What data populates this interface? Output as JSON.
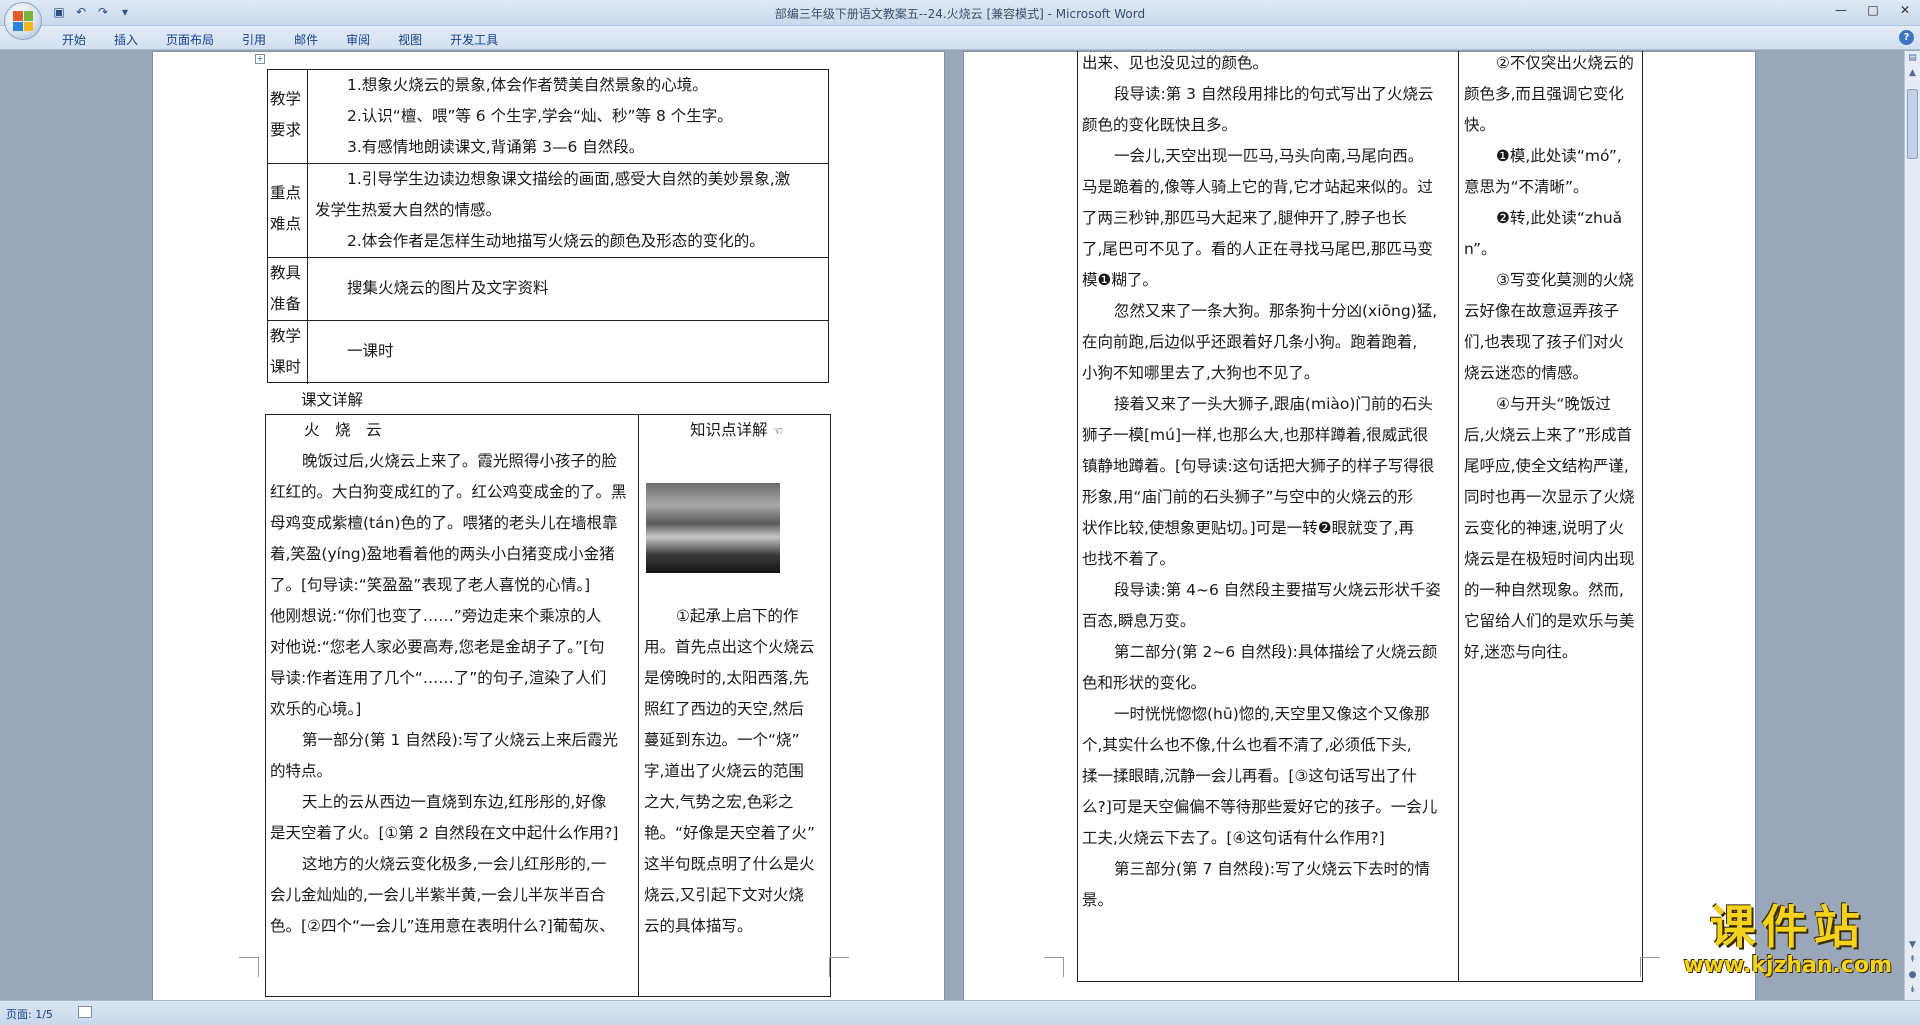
{
  "window": {
    "title": "部编三年级下册语文教案五--24.火烧云 [兼容模式] - Microsoft Word"
  },
  "ribbon": {
    "tabs": [
      "开始",
      "插入",
      "页面布局",
      "引用",
      "邮件",
      "审阅",
      "视图",
      "开发工具"
    ]
  },
  "status": {
    "page": "页面: 1/5"
  },
  "left_page": {
    "info_table": [
      {
        "label": [
          "教学",
          "要求"
        ],
        "lines": [
          "1.想象火烧云的景象,体会作者赞美自然景象的心境。",
          "2.认识“檀、喂”等 6 个生字,学会“灿、秒”等 8 个生字。",
          "3.有感情地朗读课文,背诵第 3—6 自然段。"
        ]
      },
      {
        "label": [
          "重点",
          "难点"
        ],
        "lines": [
          "1.引导学生边读边想象课文描绘的画面,感受大自然的美妙景象,激",
          "发学生热爱大自然的情感。",
          "2.体会作者是怎样生动地描写火烧云的颜色及形态的变化的。"
        ]
      },
      {
        "label": [
          "教具",
          "准备"
        ],
        "lines": [
          "搜集火烧云的图片及文字资料"
        ]
      },
      {
        "label": [
          "教学",
          "课时"
        ],
        "lines": [
          "一课时"
        ]
      }
    ],
    "section_title": "课文详解",
    "main_col": [
      "火　烧　云",
      "晚饭过后,火烧云上来了。霞光照得小孩子的脸",
      "红红的。大白狗变成红的了。红公鸡变成金的了。黑",
      "母鸡变成紫檀(tán)色的了。喂猪的老头儿在墙根靠",
      "着,笑盈(yíng)盈地看着他的两头小白猪变成小金猪",
      "了。[句导读:“笑盈盈”表现了老人喜悦的心情。]",
      "他刚想说:“你们也变了……”旁边走来个乘凉的人",
      "对他说:“您老人家必要高寿,您老是金胡子了。”[句",
      "导读:作者连用了几个“……了”的句子,渲染了人们",
      "欢乐的心境。]",
      "第一部分(第 1 自然段):写了火烧云上来后霞光",
      "的特点。",
      "天上的云从西边一直烧到东边,红彤彤的,好像",
      "是天空着了火。[①第 2 自然段在文中起什么作用?]",
      "这地方的火烧云变化极多,一会儿红彤彤的,一",
      "会儿金灿灿的,一会儿半紫半黄,一会儿半灰半百合",
      "色。[②四个“一会儿”连用意在表明什么?]葡萄灰、"
    ],
    "side_col": {
      "heading": "知识点详解",
      "lines": [
        "①起承上启下的作",
        "用。首先点出这个火烧云",
        "是傍晚时的,太阳西落,先",
        "照红了西边的天空,然后",
        "蔓延到东边。一个“烧”",
        "字,道出了火烧云的范围",
        "之大,气势之宏,色彩之",
        "艳。“好像是天空着了火”",
        "这半句既点明了什么是火",
        "烧云,又引起下文对火烧",
        "云的具体描写。"
      ]
    }
  },
  "right_page": {
    "main_col": [
      "出来、见也没见过的颜色。",
      "段导读:第 3 自然段用排比的句式写出了火烧云",
      "颜色的变化既快且多。",
      "一会儿,天空出现一匹马,马头向南,马尾向西。",
      "马是跪着的,像等人骑上它的背,它才站起来似的。过",
      "了两三秒钟,那匹马大起来了,腿伸开了,脖子也长",
      "了,尾巴可不见了。看的人正在寻找马尾巴,那匹马变",
      "模❶糊了。",
      "忽然又来了一条大狗。那条狗十分凶(xiōng)猛,",
      "在向前跑,后边似乎还跟着好几条小狗。跑着跑着,",
      "小狗不知哪里去了,大狗也不见了。",
      "接着又来了一头大狮子,跟庙(miào)门前的石头",
      "狮子一模[mú]一样,也那么大,也那样蹲着,很威武很",
      "镇静地蹲着。[句导读:这句话把大狮子的样子写得很",
      "形象,用“庙门前的石头狮子”与空中的火烧云的形",
      "状作比较,使想象更贴切。]可是一转❷眼就变了,再",
      "也找不着了。",
      "段导读:第 4~6 自然段主要描写火烧云形状千姿",
      "百态,瞬息万变。",
      "第二部分(第 2~6 自然段):具体描绘了火烧云颜",
      "色和形状的变化。",
      "一时恍恍惚惚(hū)惚的,天空里又像这个又像那",
      "个,其实什么也不像,什么也看不清了,必须低下头,",
      "揉一揉眼睛,沉静一会儿再看。[③这句话写出了什",
      "么?]可是天空偏偏不等待那些爱好它的孩子。一会儿",
      "工夫,火烧云下去了。[④这句话有什么作用?]",
      "第三部分(第 7 自然段):写了火烧云下去时的情",
      "景。"
    ],
    "side_col": [
      "②不仅突出火烧云的",
      "颜色多,而且强调它变化",
      "快。",
      "❶模,此处读“mó”,",
      "意思为“不清晰”。",
      "❷转,此处读“zhuǎ",
      "n”。",
      "③写变化莫测的火烧",
      "云好像在故意逗弄孩子",
      "们,也表现了孩子们对火",
      "烧云迷恋的情感。",
      "④与开头“晚饭过",
      "后,火烧云上来了”形成首",
      "尾呼应,使全文结构严谨,",
      "同时也再一次显示了火烧",
      "云变化的神速,说明了火",
      "烧云是在极短时间内出现",
      "的一种自然现象。然而,",
      "它留给人们的是欢乐与美",
      "好,迷恋与向往。"
    ]
  },
  "watermark": {
    "text": "课件站",
    "url": "www.kjzhan.com"
  },
  "colors": {
    "ribbon_text": "#15428b",
    "background": "#9aa7b8",
    "watermark": "#f5d21b"
  }
}
